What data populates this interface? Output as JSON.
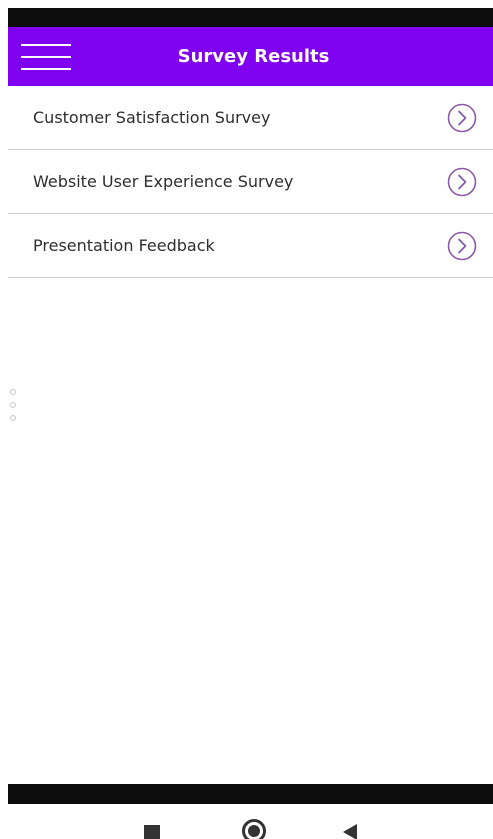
{
  "header": {
    "title": "Survey Results",
    "menu_icon": "hamburger-menu-icon",
    "background_color": "#8000f0"
  },
  "surveys": [
    {
      "label": "Customer Satisfaction Survey",
      "icon": "chevron-right-circle-icon"
    },
    {
      "label": "Website User Experience Survey",
      "icon": "chevron-right-circle-icon"
    },
    {
      "label": "Presentation Feedback",
      "icon": "chevron-right-circle-icon"
    }
  ],
  "colors": {
    "accent": "#8000f0",
    "chevron": "#8a5aa8",
    "text": "#2e2e2e",
    "divider": "#cfcfcf"
  },
  "navigation_bar": {
    "buttons": [
      "recent-apps-icon",
      "home-icon",
      "back-icon"
    ]
  }
}
